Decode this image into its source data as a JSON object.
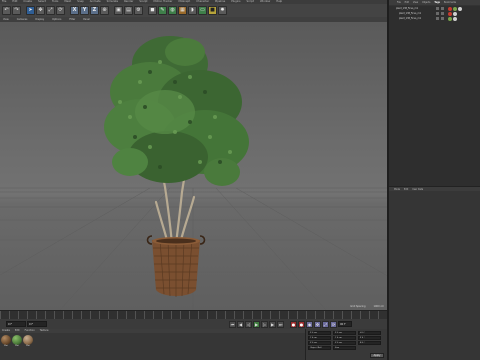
{
  "app": {
    "menu": [
      "File",
      "Edit",
      "Create",
      "Select",
      "Tools",
      "Mesh",
      "Snap",
      "Animate",
      "Simulate",
      "Render",
      "Sculpt",
      "Motion Tracker",
      "MoGraph",
      "Character",
      "Pipeline",
      "Plugins",
      "Script",
      "Window",
      "Help"
    ]
  },
  "toolbar": {
    "buttons": [
      "undo-icon",
      "redo-icon",
      "live-select-icon",
      "move-icon",
      "scale-icon",
      "rotate-icon"
    ],
    "xyz": [
      "X",
      "Y",
      "Z"
    ]
  },
  "viewport": {
    "menu": [
      "View",
      "Cameras",
      "Display",
      "Options",
      "Filter",
      "Panel"
    ],
    "status": {
      "grid_spacing_label": "Grid Spacing",
      "grid_spacing_value": "1000 cm"
    }
  },
  "transport": {
    "start_frame": "0 F",
    "current_frame": "0 F",
    "end_frame": "90 F",
    "max_frame": "90 F"
  },
  "materials": {
    "menu": [
      "Create",
      "Edit",
      "Function",
      "Texture"
    ],
    "items": [
      {
        "label": "Mat",
        "color": "#6a4a2c"
      },
      {
        "label": "Mat",
        "color": "#4b7a3a"
      },
      {
        "label": "Mat",
        "color": "#8a6a4a"
      }
    ]
  },
  "coordinates": {
    "rows": [
      [
        "X 0 cm",
        "X 0 cm",
        "H 0 °"
      ],
      [
        "Y 0 cm",
        "Y 0 cm",
        "P 0 °"
      ],
      [
        "Z 0 cm",
        "Z 0 cm",
        "B 0 °"
      ]
    ],
    "modes": [
      "Object (Rel)",
      "Size",
      "Apply"
    ]
  },
  "object_manager": {
    "tabs": [
      "File",
      "Edit",
      "View",
      "Objects",
      "Tags",
      "Bookmarks"
    ],
    "active_tab": "Tags",
    "rows": [
      {
        "name": "plant_138_Ficus_m1"
      },
      {
        "name": "plant_138_Ficus_m1"
      },
      {
        "name": "plant_138_Ficus_m1"
      }
    ],
    "tag_colors": [
      "#c53a2e",
      "#7aa34a",
      "#d0d0d0"
    ]
  },
  "attributes": {
    "tabs": [
      "Mode",
      "Edit",
      "User Data"
    ]
  }
}
